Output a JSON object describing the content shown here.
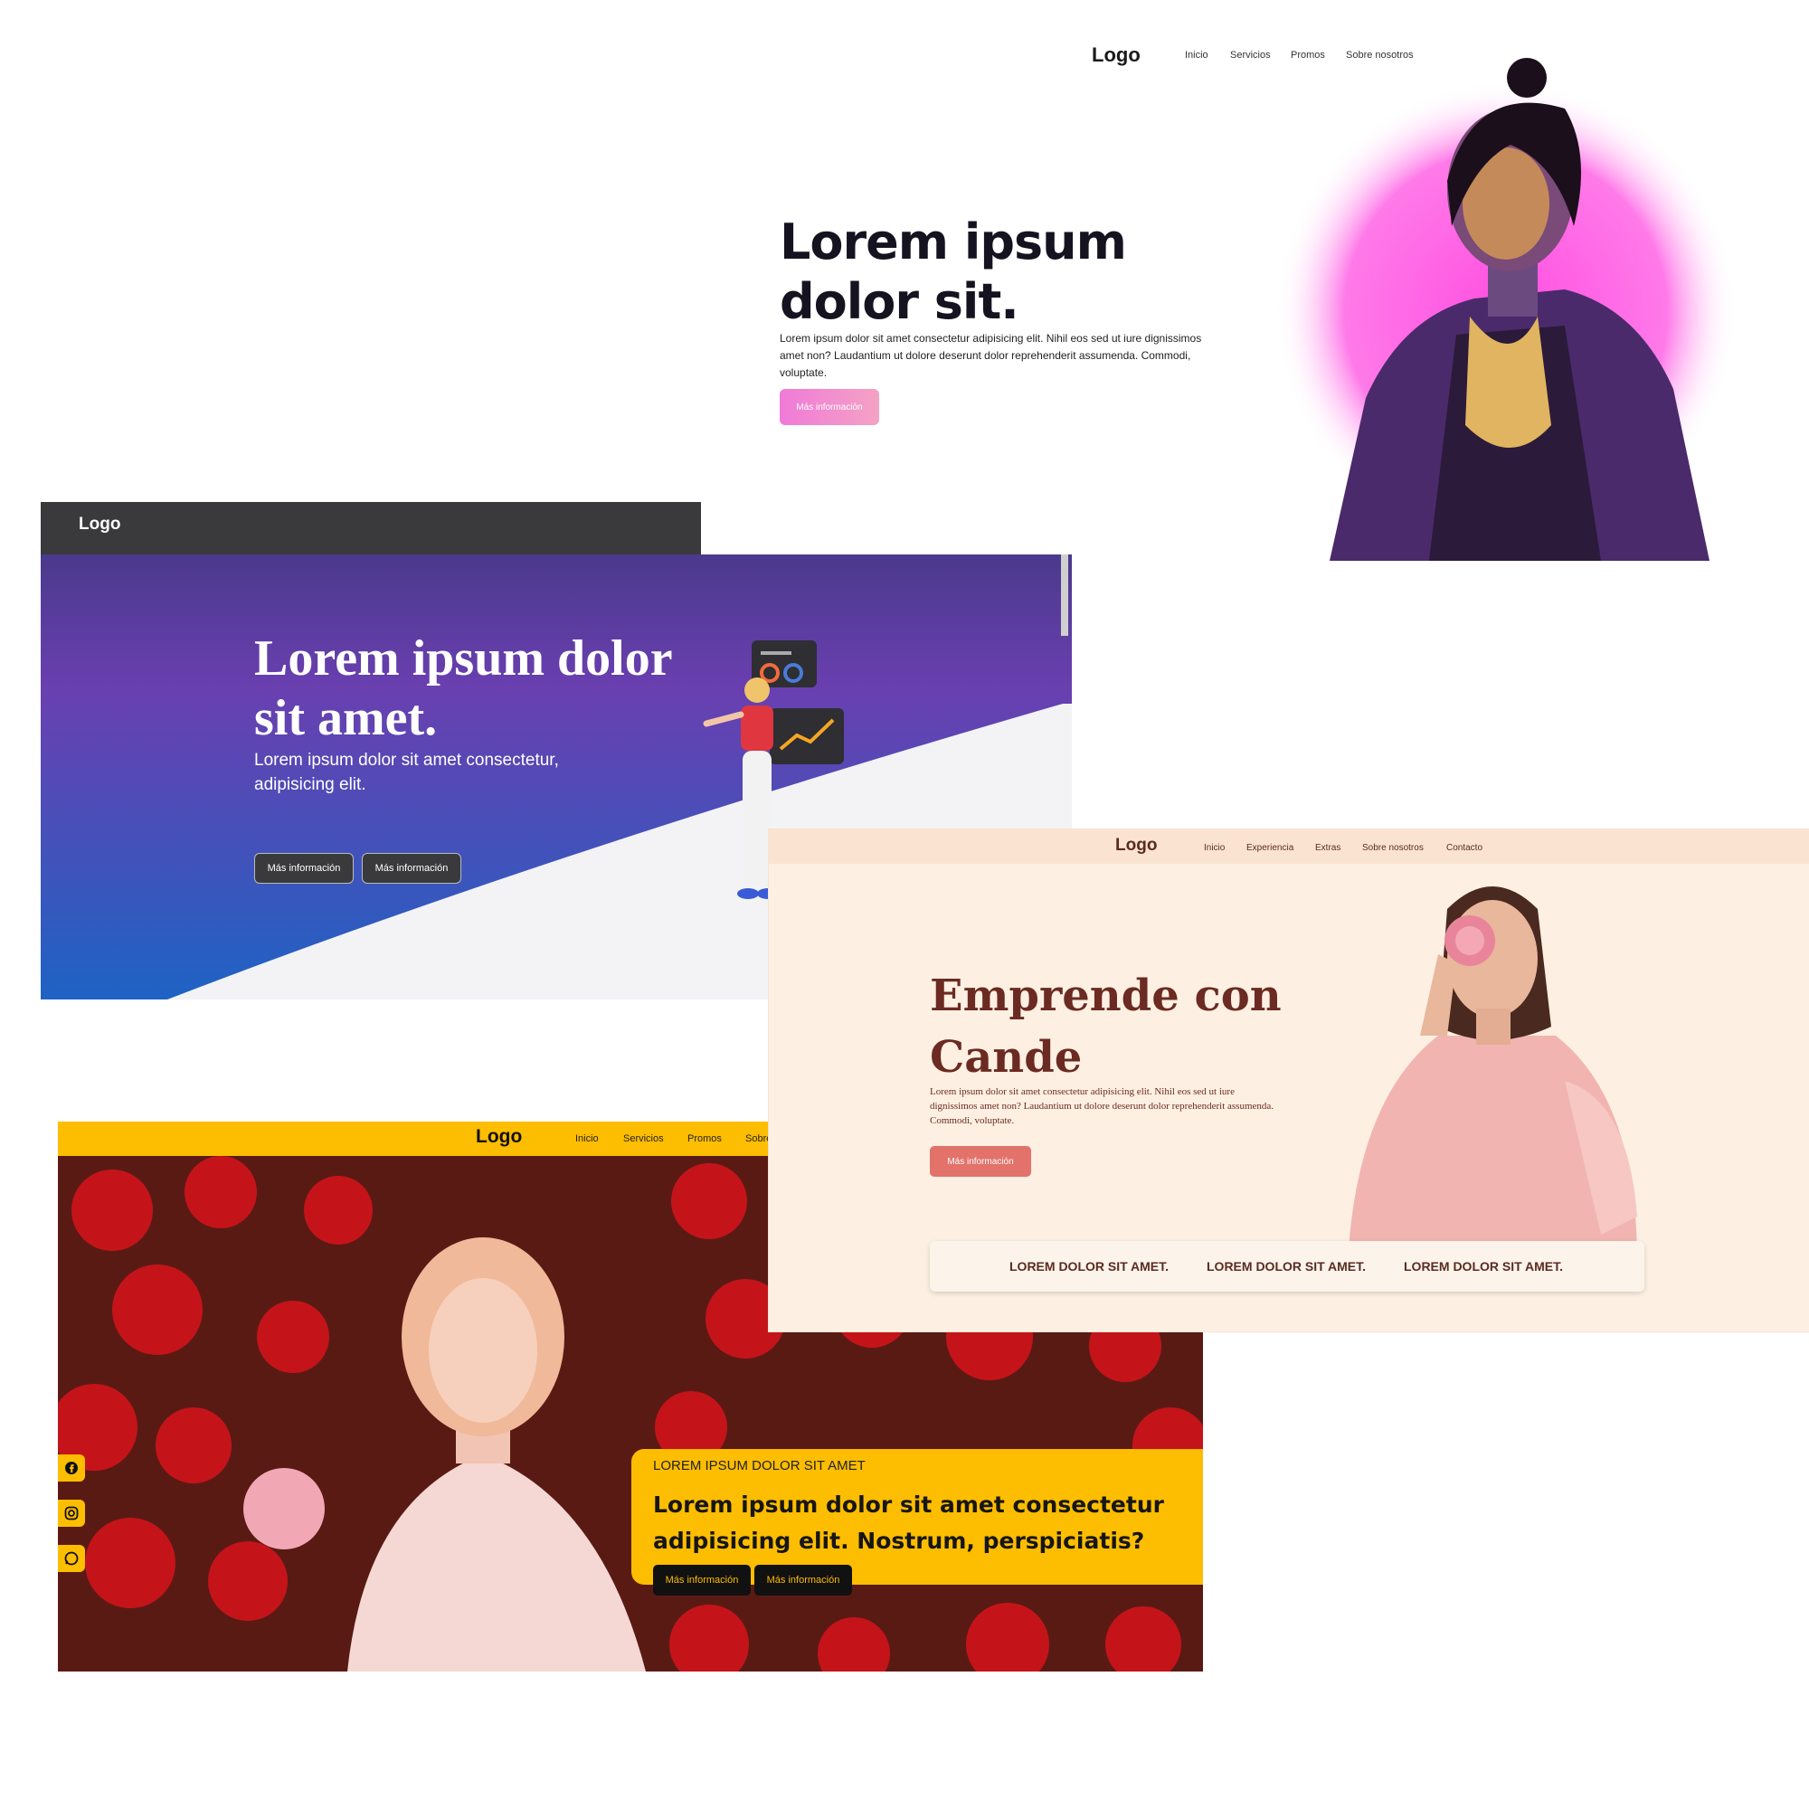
{
  "card_white": {
    "logo": "Logo",
    "nav": [
      "Inicio",
      "Servicios",
      "Promos",
      "Sobre nosotros"
    ],
    "headline": "Lorem ipsum dolor sit.",
    "paragraph": "Lorem ipsum dolor sit amet consectetur adipisicing elit. Nihil eos sed ut iure dignissimos amet non? Laudantium ut dolore deserunt dolor reprehenderit assumenda. Commodi, voluptate.",
    "button": "Más información",
    "colors": {
      "glow": "#ff6ee6",
      "button_from": "#f07ad8",
      "button_to": "#f4a2c4"
    }
  },
  "card_purple": {
    "logo": "Logo",
    "headline": "Lorem ipsum dolor sit amet.",
    "subtitle": "Lorem ipsum dolor sit amet consectetur, adipisicing elit.",
    "buttons": [
      "Más información",
      "Más información"
    ],
    "colors": {
      "gradient_top": "#4a3a8c",
      "gradient_mid": "#6a3fb0",
      "gradient_bottom": "#1e63c4"
    }
  },
  "card_yellow": {
    "logo": "Logo",
    "nav": [
      "Inicio",
      "Servicios",
      "Promos",
      "Sobre"
    ],
    "kicker": "LOREM IPSUM DOLOR SIT AMET",
    "title": "Lorem ipsum dolor sit amet consectetur adipisicing elit. Nostrum, perspiciatis?",
    "buttons": [
      "Más información",
      "Más información"
    ],
    "social_icons": [
      "facebook-icon",
      "instagram-icon",
      "whatsapp-icon"
    ],
    "colors": {
      "accent": "#fdbd00"
    }
  },
  "card_cream": {
    "logo": "Logo",
    "nav": [
      "Inicio",
      "Experiencia",
      "Extras",
      "Sobre nosotros",
      "Contacto"
    ],
    "headline": "Emprende con Cande",
    "paragraph": "Lorem ipsum dolor sit amet consectetur adipisicing elit. Nihil eos sed ut iure dignissimos amet non? Laudantium ut dolore deserunt dolor reprehenderit assumenda. Commodi, voluptate.",
    "button": "Más información",
    "features": [
      "LOREM DOLOR SIT AMET.",
      "LOREM DOLOR SIT AMET.",
      "LOREM DOLOR SIT AMET."
    ],
    "colors": {
      "background": "#fdf0e2",
      "text": "#6b2a22",
      "button": "#e3726a"
    }
  }
}
